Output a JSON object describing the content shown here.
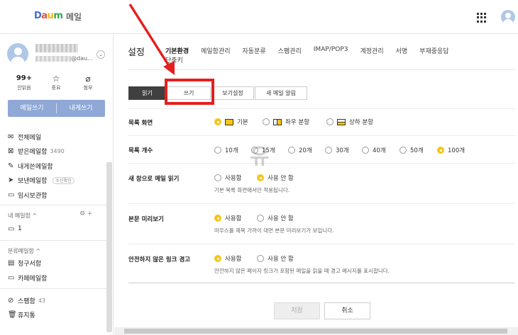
{
  "header": {
    "logo": {
      "d": "D",
      "a": "a",
      "u": "u",
      "m": "m"
    },
    "service_name": "메일"
  },
  "sidebar": {
    "profile_domain": "@dau...",
    "quick": [
      {
        "value": "99+",
        "label": "안읽음",
        "icon": "unread"
      },
      {
        "value": "☆",
        "label": "중요",
        "icon": "star-icon"
      },
      {
        "value": "⊘",
        "label": "첨부",
        "icon": "paperclip-icon"
      }
    ],
    "write_label": "메일쓰기",
    "self_write_label": "내게쓰기",
    "folders": [
      {
        "label": "전체메일",
        "icon": "mail-icon"
      },
      {
        "label": "받은메일함",
        "count": "3490",
        "icon": "inbox-icon"
      },
      {
        "label": "내게쓴메일함",
        "icon": "pencil-icon"
      },
      {
        "label": "보낸메일함",
        "badge": "수신확인",
        "icon": "send-icon"
      },
      {
        "label": "임시보관함",
        "icon": "folder-icon"
      }
    ],
    "my_mailbox_title": "내 메일함 ^",
    "my_mailbox_tools": "⚙ +",
    "my_mailbox_items": [
      {
        "label": "1"
      }
    ],
    "category_title": "분류메일함 ^",
    "category_items": [
      {
        "label": "청구서함",
        "icon": "receipt-icon"
      },
      {
        "label": "카페메일함",
        "icon": "folder-icon"
      }
    ],
    "spam": {
      "label": "스팸함",
      "count": "43"
    },
    "trash": {
      "label": "휴지통"
    }
  },
  "settings": {
    "title": "설정",
    "tabs": [
      "기본환경",
      "메일함관리",
      "자동분류",
      "스팸관리",
      "IMAP/POP3",
      "계정관리",
      "서명",
      "부재중응답"
    ],
    "active_tab": "기본환경",
    "sub_tab": "단축키",
    "segments": [
      "읽기",
      "쓰기",
      "보기설정",
      "새 메일 알림"
    ],
    "active_segment": "읽기",
    "rows": [
      {
        "label": "목록 화면",
        "options": [
          "기본",
          "좌우 분할",
          "상하 분할"
        ],
        "selected": "기본"
      },
      {
        "label": "목록 개수",
        "options": [
          "10개",
          "15개",
          "20개",
          "30개",
          "40개",
          "50개",
          "100개"
        ],
        "selected": "100개"
      },
      {
        "label": "새 창으로 메일 읽기",
        "options": [
          "사용함",
          "사용 안 함"
        ],
        "selected": "사용 안 함",
        "desc": "기본 목록 화면에서만 적용됩니다."
      },
      {
        "label": "본문 미리보기",
        "options": [
          "사용함",
          "사용 안 함"
        ],
        "selected": "사용함",
        "desc": "마우스를 제목 가까이 대면 본문 미리보기가 보입니다."
      },
      {
        "label": "안전하지 않은 링크 경고",
        "options": [
          "사용함",
          "사용 안 함"
        ],
        "selected": "사용함",
        "desc": "안전하지 않은 페이지 링크가 포함된 메일을 읽을 때 경고 메시지를 표시합니다."
      }
    ],
    "save_label": "저장",
    "cancel_label": "취소"
  },
  "annotation": {
    "watermark": "유",
    "arrow_color": "#e61e1e",
    "highlight_color": "#e61e1e"
  },
  "colors": {
    "accent_yellow": "#f5c518",
    "write_button": "#8fa8d6",
    "active_segment": "#404040"
  }
}
